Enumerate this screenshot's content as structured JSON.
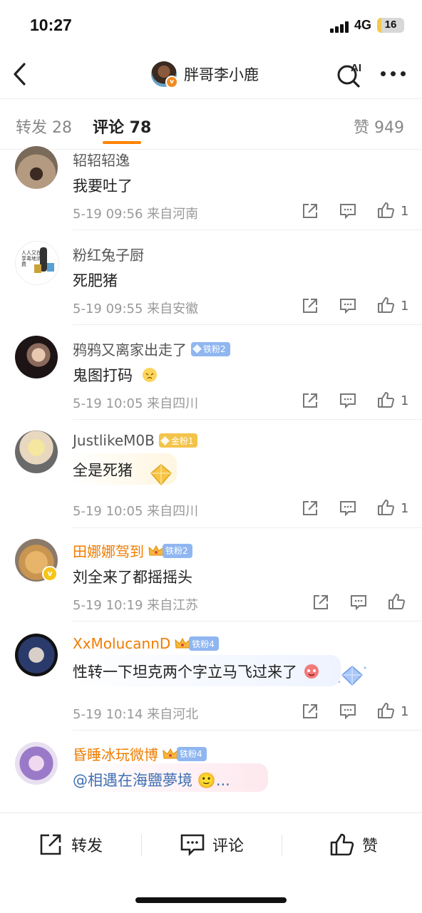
{
  "status_bar": {
    "time": "10:27",
    "network": "4G",
    "battery": "16",
    "battery_level": 0.16
  },
  "header": {
    "title": "胖哥李小鹿",
    "ai_label": "AI"
  },
  "tabs": {
    "repost": "转发 28",
    "comments": "评论 78",
    "likes": "赞 949"
  },
  "comments": [
    {
      "name": "轺轺轺逸",
      "text": "我要吐了",
      "meta": "5-19 09:56  来自河南",
      "likes": "1"
    },
    {
      "name": "粉红兔子厨",
      "text": "死肥猪",
      "meta": "5-19 09:55  来自安徽",
      "likes": "1"
    },
    {
      "name": "鸦鸦又离家出走了",
      "badge": "铁粉2",
      "text": "鬼图打码",
      "meta": "5-19 10:05  来自四川",
      "likes": "1"
    },
    {
      "name": "JustlikeM0B",
      "badge": "金粉1",
      "text": "全是死猪",
      "meta": "5-19 10:05  来自四川",
      "likes": "1"
    },
    {
      "name": "田娜娜驾到",
      "badge": "铁粉2",
      "text": "刘全来了都摇摇头",
      "meta": "5-19 10:19  来自江苏",
      "likes": ""
    },
    {
      "name": "XxMolucannD",
      "badge": "铁粉4",
      "text": "性转一下坦克两个字立马飞过来了",
      "meta": "5-19 10:14  来自河北",
      "likes": "1"
    },
    {
      "name": "昏睡冰玩微博",
      "badge": "铁粉4",
      "text": "@相遇在海鹽夢境 🙂..."
    }
  ],
  "avatar_text": "人人又在 享毒地消费",
  "bottom_bar": {
    "repost": "转发",
    "comment": "评论",
    "like": "赞"
  },
  "colors": {
    "accent": "#ff8200",
    "vip_name": "#f07c00",
    "iron_badge": "#8fb6f0",
    "gold_badge": "#f3c44b"
  }
}
